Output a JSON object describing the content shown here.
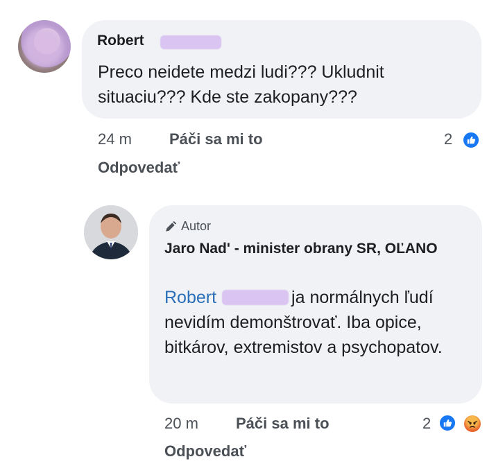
{
  "comment": {
    "author": "Robert",
    "text": "Preco neidete medzi ludi??? Ukludnit situaciu??? Kde ste zakopany???",
    "time": "24 m",
    "like_label": "Páči sa mi to",
    "reply_label": "Odpovedať",
    "reaction_count": "2",
    "reaction_icons": [
      "like-icon"
    ]
  },
  "reply": {
    "badge_label": "Autor",
    "author": "Jaro Nad' - minister obrany SR, OĽANO",
    "mention": "Robert",
    "text": "ja normálnych ľudí nevidím demonštrovať. Iba opice, bitkárov, extremistov a psychopatov.",
    "time": "20 m",
    "like_label": "Páči sa mi to",
    "reply_label": "Odpovedať",
    "reaction_count": "2",
    "reaction_icons": [
      "like-icon",
      "angry-icon"
    ]
  },
  "colors": {
    "bubble": "#f0f2f5",
    "like_blue": "#1877f2",
    "mention_blue": "#2a6fb8",
    "redaction": "#d9c4f2"
  }
}
